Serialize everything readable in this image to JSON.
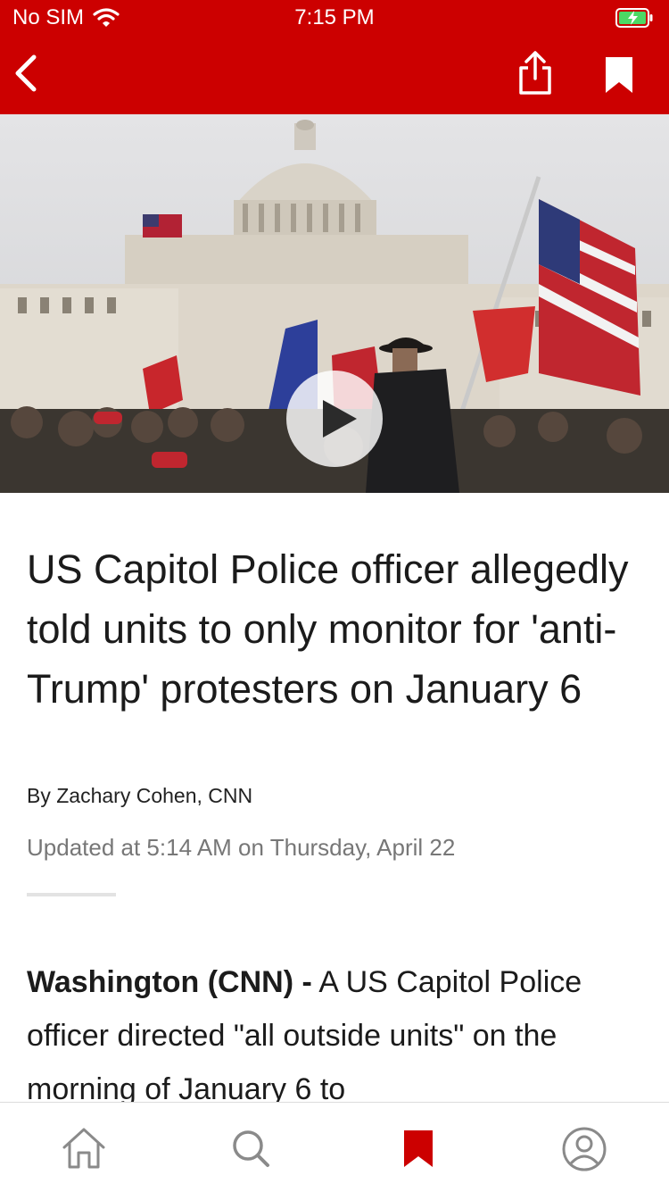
{
  "status_bar": {
    "carrier": "No SIM",
    "time": "7:15 PM",
    "wifi_icon": "wifi-icon",
    "battery_icon": "battery-charging-icon"
  },
  "nav": {
    "back_icon": "chevron-left-icon",
    "share_icon": "share-icon",
    "bookmark_icon": "bookmark-icon",
    "brand_color": "#cc0000"
  },
  "hero": {
    "play_icon": "play-icon"
  },
  "article": {
    "headline": "US Capitol Police officer allegedly told units to only monitor for 'anti-Trump' protesters on January 6",
    "byline": "By Zachary Cohen, CNN",
    "updated": "Updated at 5:14 AM on Thursday, April 22",
    "dateline": "Washington  (CNN) -",
    "body_text": " A US Capitol Police officer directed \"all outside units\" on the morning of January 6 to"
  },
  "tabbar": {
    "items": [
      {
        "name": "home",
        "icon": "home-icon",
        "active": false
      },
      {
        "name": "search",
        "icon": "search-icon",
        "active": false
      },
      {
        "name": "saved",
        "icon": "bookmark-icon",
        "active": true
      },
      {
        "name": "account",
        "icon": "profile-icon",
        "active": false
      }
    ],
    "active_color": "#cc0000",
    "inactive_color": "#8a8a8a"
  }
}
